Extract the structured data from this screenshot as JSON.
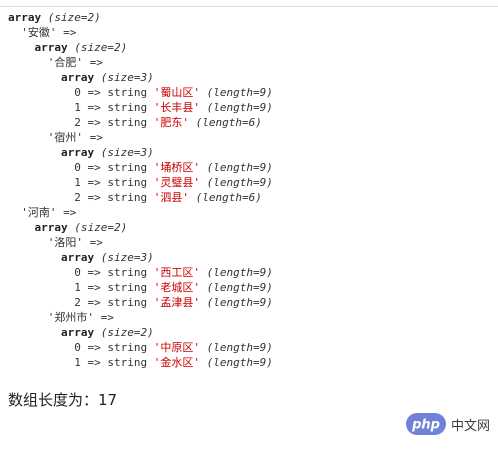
{
  "dump": {
    "root_kw": "array",
    "root_meta": "(size=2)",
    "groups": [
      {
        "key": "'安徽'",
        "kw": "array",
        "meta": "(size=2)",
        "cities": [
          {
            "key": "'合肥'",
            "kw": "array",
            "meta": "(size=3)",
            "items": [
              {
                "idx": "0",
                "type": "string",
                "val": "'蜀山区'",
                "len": "(length=9)"
              },
              {
                "idx": "1",
                "type": "string",
                "val": "'长丰县'",
                "len": "(length=9)"
              },
              {
                "idx": "2",
                "type": "string",
                "val": "'肥东'",
                "len": "(length=6)"
              }
            ]
          },
          {
            "key": "'宿州'",
            "kw": "array",
            "meta": "(size=3)",
            "items": [
              {
                "idx": "0",
                "type": "string",
                "val": "'埇桥区'",
                "len": "(length=9)"
              },
              {
                "idx": "1",
                "type": "string",
                "val": "'灵璧县'",
                "len": "(length=9)"
              },
              {
                "idx": "2",
                "type": "string",
                "val": "'泗县'",
                "len": "(length=6)"
              }
            ]
          }
        ]
      },
      {
        "key": "'河南'",
        "kw": "array",
        "meta": "(size=2)",
        "cities": [
          {
            "key": "'洛阳'",
            "kw": "array",
            "meta": "(size=3)",
            "items": [
              {
                "idx": "0",
                "type": "string",
                "val": "'西工区'",
                "len": "(length=9)"
              },
              {
                "idx": "1",
                "type": "string",
                "val": "'老城区'",
                "len": "(length=9)"
              },
              {
                "idx": "2",
                "type": "string",
                "val": "'孟津县'",
                "len": "(length=9)"
              }
            ]
          },
          {
            "key": "'郑州市'",
            "kw": "array",
            "meta": "(size=2)",
            "items": [
              {
                "idx": "0",
                "type": "string",
                "val": "'中原区'",
                "len": "(length=9)"
              },
              {
                "idx": "1",
                "type": "string",
                "val": "'金水区'",
                "len": "(length=9)"
              }
            ]
          }
        ]
      }
    ]
  },
  "footer": {
    "text": "数组长度为：17"
  },
  "watermark": {
    "badge_text": "php",
    "site_text": "中文网",
    "badge_color": "#6b7bd6"
  },
  "colors": {
    "string_value": "#cc0000",
    "text": "#222222"
  }
}
